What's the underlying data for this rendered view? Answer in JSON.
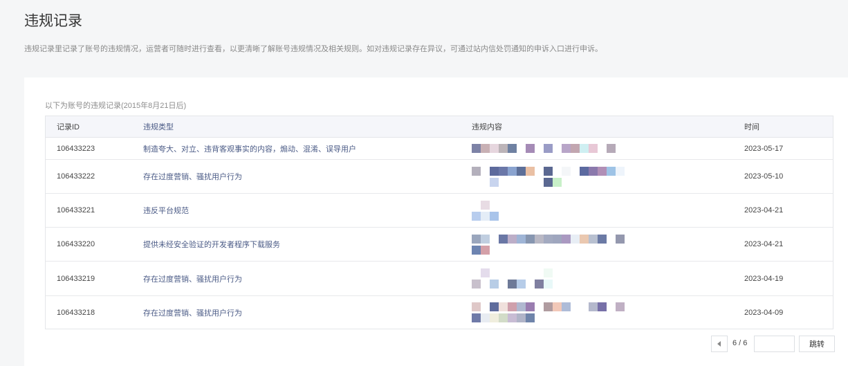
{
  "page": {
    "title": "违规记录",
    "description": "违规记录里记录了账号的违规情况，运营者可随时进行查看，以更清晰了解账号违规情况及相关规则。如对违规记录存在异议，可通过站内信处罚通知的申诉入口进行申诉。"
  },
  "records": {
    "subtitle": "以下为账号的违规记录(2015年8月21日后)",
    "columns": [
      "记录ID",
      "违规类型",
      "违规内容",
      "时间"
    ],
    "rows": [
      {
        "id": "106433223",
        "type": "制造夸大、对立、违背客观事实的内容，煽动、混淆、误导用户",
        "time": "2023-05-17"
      },
      {
        "id": "106433222",
        "type": "存在过度营销、骚扰用户行为",
        "time": "2023-05-10"
      },
      {
        "id": "106433221",
        "type": "违反平台规范",
        "time": "2023-04-21"
      },
      {
        "id": "106433220",
        "type": "提供未经安全验证的开发者程序下载服务",
        "time": "2023-04-21"
      },
      {
        "id": "106433219",
        "type": "存在过度营销、骚扰用户行为",
        "time": "2023-04-19"
      },
      {
        "id": "106433218",
        "type": "存在过度营销、骚扰用户行为",
        "time": "2023-04-09"
      }
    ]
  },
  "pagination": {
    "page_text": "6 / 6",
    "jump_label": "跳转",
    "prev_icon": "triangle-left-icon"
  }
}
